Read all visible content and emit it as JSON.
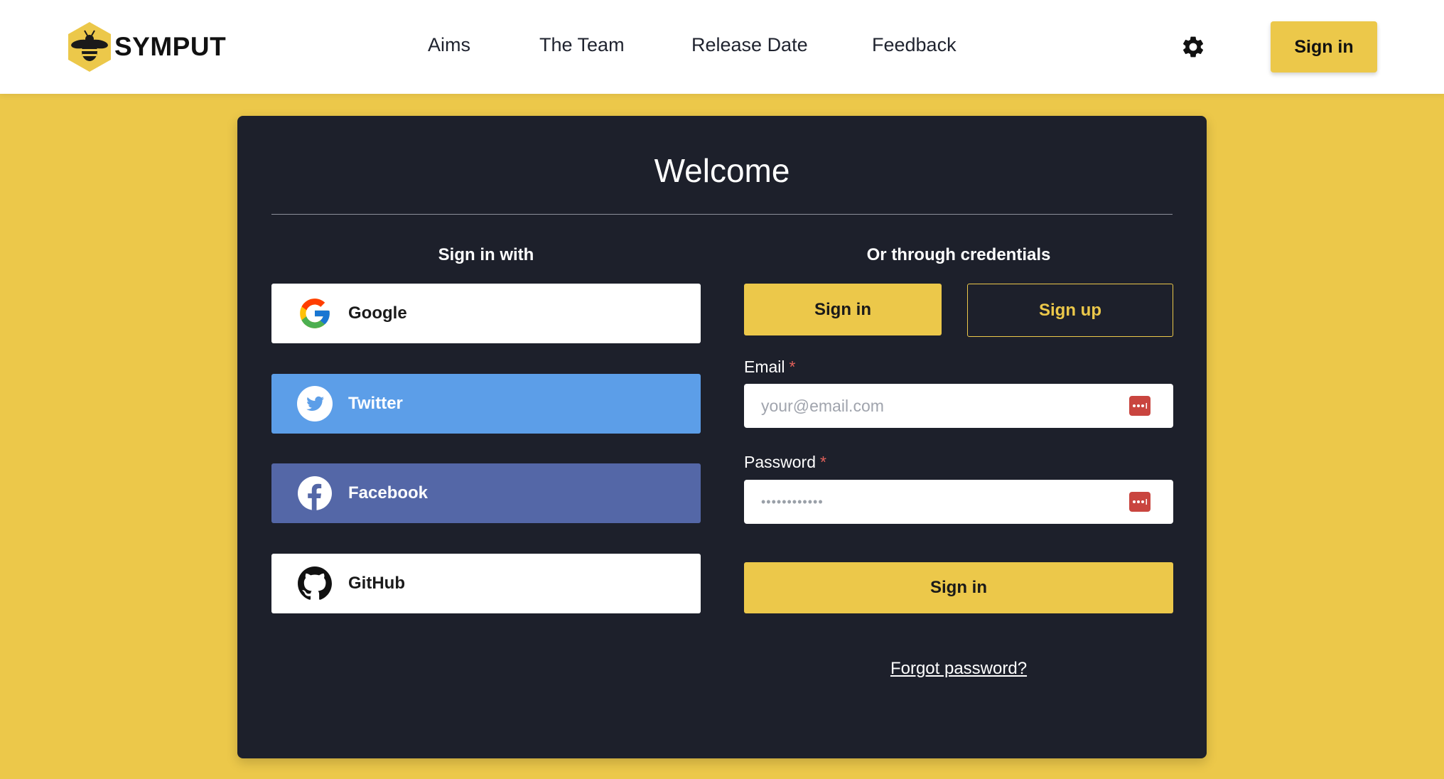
{
  "brand": {
    "name": "SYMPUT",
    "logo_icon": "bee-hexagon-logo"
  },
  "nav": {
    "items": [
      {
        "label": "Aims"
      },
      {
        "label": "The Team"
      },
      {
        "label": "Release Date"
      },
      {
        "label": "Feedback"
      }
    ],
    "settings_icon": "gear-icon",
    "signin_label": "Sign in"
  },
  "card": {
    "title": "Welcome",
    "social": {
      "heading": "Sign in with",
      "buttons": [
        {
          "label": "Google",
          "icon": "google-icon",
          "color": "#ffffff"
        },
        {
          "label": "Twitter",
          "icon": "twitter-icon",
          "color": "#5c9ee8"
        },
        {
          "label": "Facebook",
          "icon": "facebook-icon",
          "color": "#5467a7"
        },
        {
          "label": "GitHub",
          "icon": "github-icon",
          "color": "#ffffff"
        }
      ]
    },
    "credentials": {
      "heading": "Or through credentials",
      "tab_signin": "Sign in",
      "tab_signup": "Sign up",
      "email": {
        "label": "Email",
        "required_mark": "*",
        "placeholder": "your@email.com",
        "value": ""
      },
      "password": {
        "label": "Password",
        "required_mark": "*",
        "masked_value": "••••••••••••"
      },
      "submit_label": "Sign in",
      "forgot_label": "Forgot password?"
    }
  },
  "colors": {
    "accent": "#ecc84a",
    "card_bg": "#1d202b",
    "required": "#e0605a",
    "password_manager": "#c9453f"
  }
}
